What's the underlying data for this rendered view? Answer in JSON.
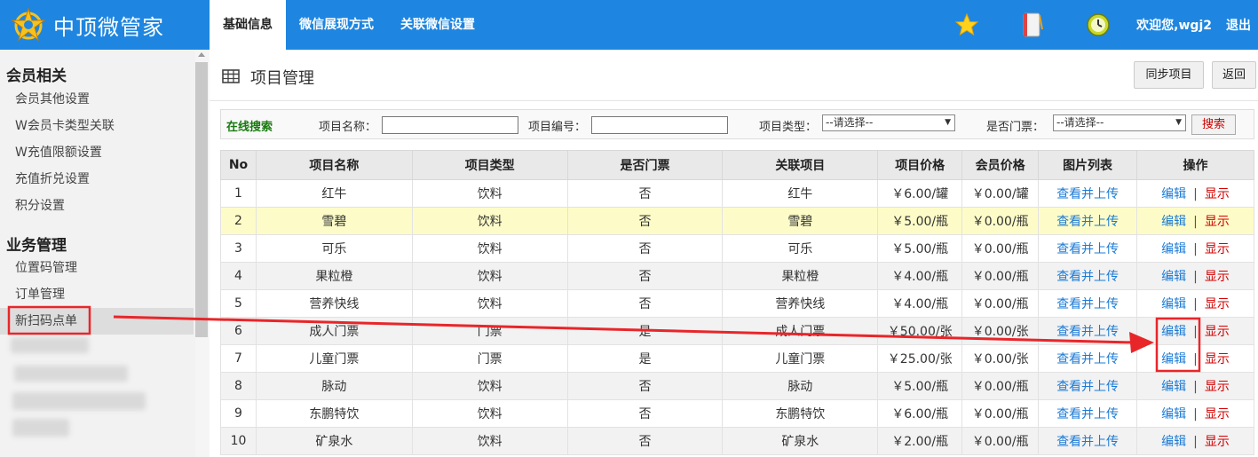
{
  "header": {
    "logo_text": "中顶微管家",
    "nav": [
      "基础信息",
      "微信展现方式",
      "关联微信设置"
    ],
    "welcome": "欢迎您,wgj2",
    "logout": "退出",
    "icons": [
      "star-icon",
      "notebook-icon",
      "clock-icon"
    ]
  },
  "sidebar": {
    "group1": "会员相关",
    "group1_items": [
      "会员其他设置",
      "W会员卡类型关联",
      "W充值限额设置",
      "充值折兑设置",
      "积分设置"
    ],
    "group2": "业务管理",
    "group2_items": [
      "位置码管理",
      "订单管理",
      "新扫码点单"
    ]
  },
  "page": {
    "title": "项目管理",
    "sync_button": "同步项目",
    "back_button": "返回"
  },
  "search": {
    "title": "在线搜索",
    "name_label": "项目名称：",
    "code_label": "项目编号：",
    "type_label": "项目类型：",
    "type_value": "--请选择--",
    "ticket_label": "是否门票：",
    "ticket_value": "--请选择--",
    "button": "搜索"
  },
  "table": {
    "headers": [
      "No",
      "项目名称",
      "项目类型",
      "是否门票",
      "关联项目",
      "项目价格",
      "会员价格",
      "图片列表",
      "操作"
    ],
    "rows": [
      [
        "1",
        "红牛",
        "饮料",
        "否",
        "红牛",
        "￥6.00/罐",
        "￥0.00/罐"
      ],
      [
        "2",
        "雪碧",
        "饮料",
        "否",
        "雪碧",
        "￥5.00/瓶",
        "￥0.00/瓶"
      ],
      [
        "3",
        "可乐",
        "饮料",
        "否",
        "可乐",
        "￥5.00/瓶",
        "￥0.00/瓶"
      ],
      [
        "4",
        "果粒橙",
        "饮料",
        "否",
        "果粒橙",
        "￥4.00/瓶",
        "￥0.00/瓶"
      ],
      [
        "5",
        "营养快线",
        "饮料",
        "否",
        "营养快线",
        "￥4.00/瓶",
        "￥0.00/瓶"
      ],
      [
        "6",
        "成人门票",
        "门票",
        "是",
        "成人门票",
        "￥50.00/张",
        "￥0.00/张"
      ],
      [
        "7",
        "儿童门票",
        "门票",
        "是",
        "儿童门票",
        "￥25.00/张",
        "￥0.00/张"
      ],
      [
        "8",
        "脉动",
        "饮料",
        "否",
        "脉动",
        "￥5.00/瓶",
        "￥0.00/瓶"
      ],
      [
        "9",
        "东鹏特饮",
        "饮料",
        "否",
        "东鹏特饮",
        "￥6.00/瓶",
        "￥0.00/瓶"
      ],
      [
        "10",
        "矿泉水",
        "饮料",
        "否",
        "矿泉水",
        "￥2.00/瓶",
        "￥0.00/瓶"
      ]
    ],
    "image_link": "查看并上传",
    "edit_link": "编辑",
    "op_separator": "|",
    "show_link": "显示"
  },
  "colors": {
    "topbar": "#1e86e0",
    "annotation": "#e8262a",
    "link_blue": "#1c7bd6",
    "link_red": "#d40000",
    "highlight_row": "#fdfcc8"
  }
}
